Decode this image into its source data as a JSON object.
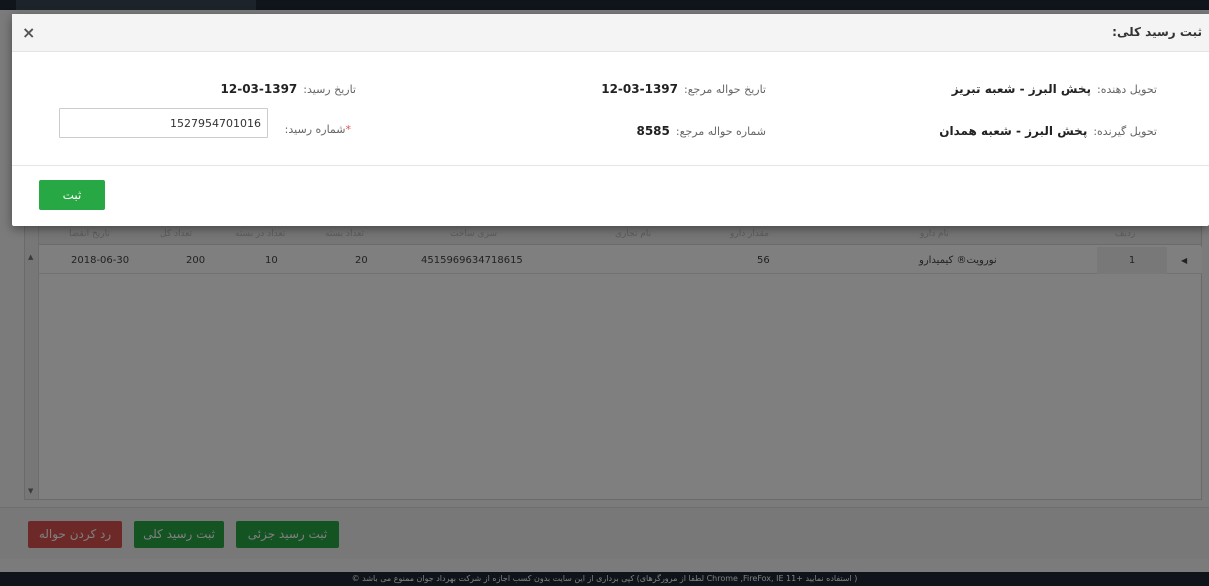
{
  "background": {
    "grid": {
      "headers": [
        "تاریخ انقضا",
        "تعداد کل",
        "تعداد در بسته",
        "تعداد بسته",
        "سری ساخت",
        "نام تجاری",
        "مقدار دارو",
        "نام دارو",
        "ردیف"
      ],
      "rows": [
        {
          "row_number": "1",
          "drug_name": "نورویت® کیمیدارو",
          "amount": "56",
          "brand": "",
          "batch": "4515969634718615",
          "packs": "20",
          "per_pack": "10",
          "total": "200",
          "expiry": "2018-06-30"
        }
      ]
    },
    "actions": {
      "reject_label": "رد کردن حواله",
      "full_receipt_label": "ثبت رسید کلی",
      "partial_receipt_label": "ثبت رسید جزئی"
    },
    "footer_text": "© کپی برداری از این سایت بدون کسب اجازه از شرکت بهرداد جوان ممنوع می باشد (لطفا از مرورگرهای Chrome ,FireFox, IE 11+ استفاده نمایید )"
  },
  "modal": {
    "title": "ثبت رسید کلی:",
    "close_glyph": "×",
    "deliverer": {
      "label": "تحویل دهنده:",
      "value": "پخش البرز - شعبه تبریز"
    },
    "receiver": {
      "label": "تحویل گیرنده:",
      "value": "پخش البرز - شعبه همدان"
    },
    "ref_date": {
      "label": "تاریخ حواله مرجع:",
      "value": "1397-03-12"
    },
    "ref_number": {
      "label": "شماره حواله مرجع:",
      "value": "8585"
    },
    "receipt_date": {
      "label": "تاریخ رسید:",
      "value": "1397-03-12"
    },
    "receipt_number": {
      "required_mark": "*",
      "label": "شماره رسید:",
      "value": "1527954701016"
    },
    "submit_label": "ثبت"
  },
  "colors": {
    "green": "#28a745",
    "red": "#d9534f",
    "footer": "#1d2835"
  }
}
